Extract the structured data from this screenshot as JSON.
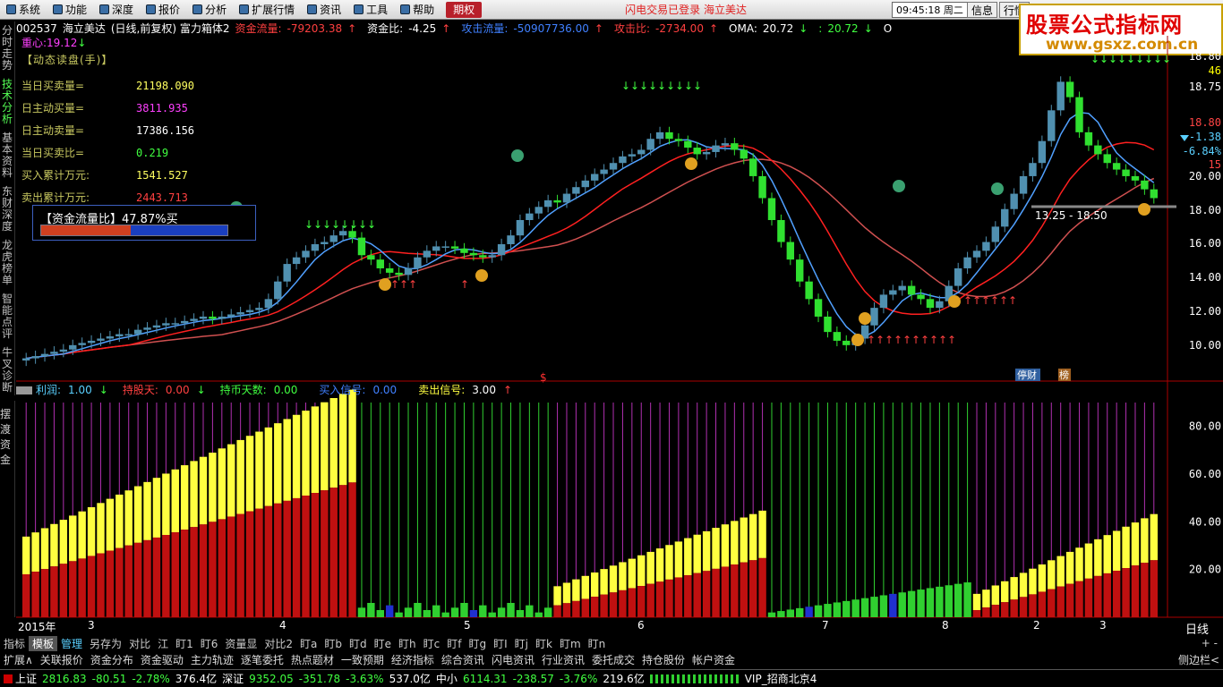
{
  "menu": {
    "items": [
      {
        "label": "系统",
        "icon": "system-icon"
      },
      {
        "label": "功能",
        "icon": "function-icon"
      },
      {
        "label": "深度",
        "icon": "depth-icon"
      },
      {
        "label": "报价",
        "icon": "quote-icon"
      },
      {
        "label": "分析",
        "icon": "analysis-icon"
      },
      {
        "label": "扩展行情",
        "icon": "ext-icon"
      },
      {
        "label": "资讯",
        "icon": "news-icon"
      },
      {
        "label": "工具",
        "icon": "tool-icon"
      },
      {
        "label": "帮助",
        "icon": "help-icon"
      }
    ],
    "period": "期权",
    "status": "闪电交易已登录  海立美达",
    "clock": "09:45:18 周二",
    "btn_info": "信息",
    "btn_quote": "行情"
  },
  "logo": {
    "line1": "股票公式指标网",
    "line2": "www.gsxz.com.cn"
  },
  "info": {
    "code": "002537",
    "name": "海立美达",
    "desc": "(日线,前复权) 富力箱体2",
    "items": [
      {
        "label": "资金流量:",
        "value": "-79203.38",
        "arrow": "↑",
        "color": "#ff4040"
      },
      {
        "label": "资金比:",
        "value": "-4.25",
        "arrow": "↑",
        "color": "#ffffff"
      },
      {
        "label": "攻击流量:",
        "value": "-50907736.00",
        "arrow": "↑",
        "color": "#4080ff"
      },
      {
        "label": "攻击比:",
        "value": "-2734.00",
        "arrow": "↑",
        "color": "#ff4040"
      },
      {
        "label": "OMA:",
        "value": "20.72",
        "arrow": "↓",
        "color": "#ffffff"
      },
      {
        "label": ":",
        "value": "20.72",
        "arrow": "↓",
        "color": "#40ff40"
      },
      {
        "label": "O",
        "value": "",
        "arrow": "",
        "color": "#ffffff"
      }
    ],
    "center_label": "重心:",
    "center_value": "19.12",
    "center_arrow": "↓"
  },
  "sidebar": {
    "top": [
      "分时走势",
      "技术分析",
      "基本资料",
      "东财深度",
      "龙虎榜单",
      "智能点评",
      "牛叉诊断"
    ],
    "bottom": "摆渡资金"
  },
  "readpanel": {
    "header": "【动态读盘(手)】",
    "rows": [
      {
        "label": "当日买卖量=",
        "value": "21198.090",
        "color": "#ffff60"
      },
      {
        "label": "日主动买量=",
        "value": "3811.935",
        "color": "#ff40ff"
      },
      {
        "label": "日主动卖量=",
        "value": "17386.156",
        "color": "#ffffff"
      },
      {
        "label": "当日买卖比=",
        "value": "0.219",
        "color": "#40ff40"
      },
      {
        "label": "买入累计万元:",
        "value": "1541.527",
        "color": "#ffff60"
      },
      {
        "label": "卖出累计万元:",
        "value": "2443.713",
        "color": "#ff4040"
      }
    ]
  },
  "flowbox": {
    "label": "【资金流量比】47.87%买",
    "ratio": 0.4787
  },
  "chart_data": {
    "type": "candlestick",
    "ylim": [
      9,
      19.5
    ],
    "yticks": [
      "18.80",
      "18.75",
      "18.80",
      "18.00",
      "16.00",
      "14.00",
      "12.00",
      "10.00"
    ],
    "closes": [
      10.7,
      10.8,
      10.9,
      11.0,
      11.1,
      11.3,
      11.4,
      11.5,
      11.6,
      11.7,
      11.8,
      11.8,
      12.0,
      12.1,
      12.2,
      12.3,
      12.3,
      12.4,
      12.5,
      12.6,
      12.5,
      12.6,
      12.7,
      12.8,
      12.9,
      13.0,
      13.4,
      14.2,
      15.0,
      15.3,
      15.6,
      15.9,
      16.0,
      16.3,
      16.5,
      16.2,
      15.4,
      15.2,
      14.8,
      14.6,
      14.5,
      14.8,
      15.3,
      15.6,
      15.8,
      15.8,
      15.7,
      15.5,
      15.4,
      15.3,
      15.4,
      15.9,
      16.3,
      17.0,
      17.3,
      17.6,
      17.9,
      17.8,
      18.2,
      18.5,
      18.8,
      19.1,
      19.3,
      19.6,
      19.9,
      20.0,
      20.2,
      20.7,
      21.0,
      20.7,
      20.6,
      20.3,
      20.0,
      20.1,
      20.4,
      20.5,
      20.2,
      19.8,
      19.0,
      18.0,
      17.0,
      16.0,
      15.2,
      14.2,
      13.4,
      12.6,
      11.9,
      11.5,
      11.3,
      11.6,
      12.2,
      13.0,
      13.6,
      13.8,
      14.0,
      13.6,
      13.4,
      13.0,
      13.3,
      14.0,
      14.8,
      15.3,
      15.6,
      16.0,
      16.7,
      17.5,
      18.2,
      19.0,
      19.6,
      20.6,
      22.0,
      23.3,
      22.6,
      21.0,
      20.4,
      20.0,
      19.6,
      19.3,
      19.0,
      18.8,
      18.4,
      18.0
    ],
    "y_axis_labels": [
      "18.80",
      "46",
      "18.75",
      "18.80",
      "-1.38",
      "-6.84%",
      "15",
      "20.00",
      "18.00",
      "16.00",
      "14.00",
      "12.00",
      "10.00"
    ],
    "range_label": "13.25 - 18.50",
    "badge_caifu": "停财",
    "badge_bang": "榜",
    "dollar": "$"
  },
  "ind2": {
    "items": [
      {
        "label": "利润:",
        "value": "1.00",
        "arrow": "↓",
        "lcolor": "#5ad0ff",
        "vcolor": "#5ad0ff"
      },
      {
        "label": "持股天:",
        "value": "0.00",
        "arrow": "↓",
        "lcolor": "#ff4040",
        "vcolor": "#ff4040"
      },
      {
        "label": "持币天数:",
        "value": "0.00",
        "arrow": "",
        "lcolor": "#40ff40",
        "vcolor": "#40ff40"
      },
      {
        "label": "买入信号:",
        "value": "0.00",
        "arrow": "",
        "lcolor": "#4080ff",
        "vcolor": "#4080ff"
      },
      {
        "label": "卖出信号:",
        "value": "3.00",
        "arrow": "↑",
        "lcolor": "#ffff40",
        "vcolor": "#ffffff"
      }
    ],
    "yticks": [
      "80.00",
      "60.00",
      "40.00",
      "20.00"
    ]
  },
  "xaxis": {
    "labels": [
      "2015年",
      "3",
      "4",
      "5",
      "6",
      "7",
      "8",
      "2",
      "3"
    ],
    "day": "日线"
  },
  "tabs1": [
    "指标",
    "模板",
    "管理",
    "另存为",
    "对比",
    "江",
    "盯1",
    "盯6",
    "资量显",
    "对比2",
    "盯a",
    "盯b",
    "盯d",
    "盯e",
    "盯h",
    "盯c",
    "盯f",
    "盯g",
    "盯I",
    "盯j",
    "盯k",
    "盯m",
    "盯n"
  ],
  "tabs1_right": "+ - ",
  "tabs2": [
    "扩展∧",
    "关联报价",
    "资金分布",
    "资金驱动",
    "主力轨迹",
    "逐笔委托",
    "热点题材",
    "一致预期",
    "经济指标",
    "综合资讯",
    "闪电资讯",
    "行业资讯",
    "委托成交",
    "持仓股份",
    "帐户资金"
  ],
  "tabs2_right": "侧边栏<",
  "status": {
    "sh_label": "上证",
    "sh": "2816.83",
    "sh_chg": "-80.51",
    "sh_pct": "-2.78%",
    "sh_amt": "376.4亿",
    "sz_label": "深证",
    "sz": "9352.05",
    "sz_chg": "-351.78",
    "sz_pct": "-3.63%",
    "sz_amt": "537.0亿",
    "zx_label": "中小",
    "zx": "6114.31",
    "zx_chg": "-238.57",
    "zx_pct": "-3.76%",
    "zx_amt": "219.6亿",
    "vip": "VIP_招商北京4"
  }
}
